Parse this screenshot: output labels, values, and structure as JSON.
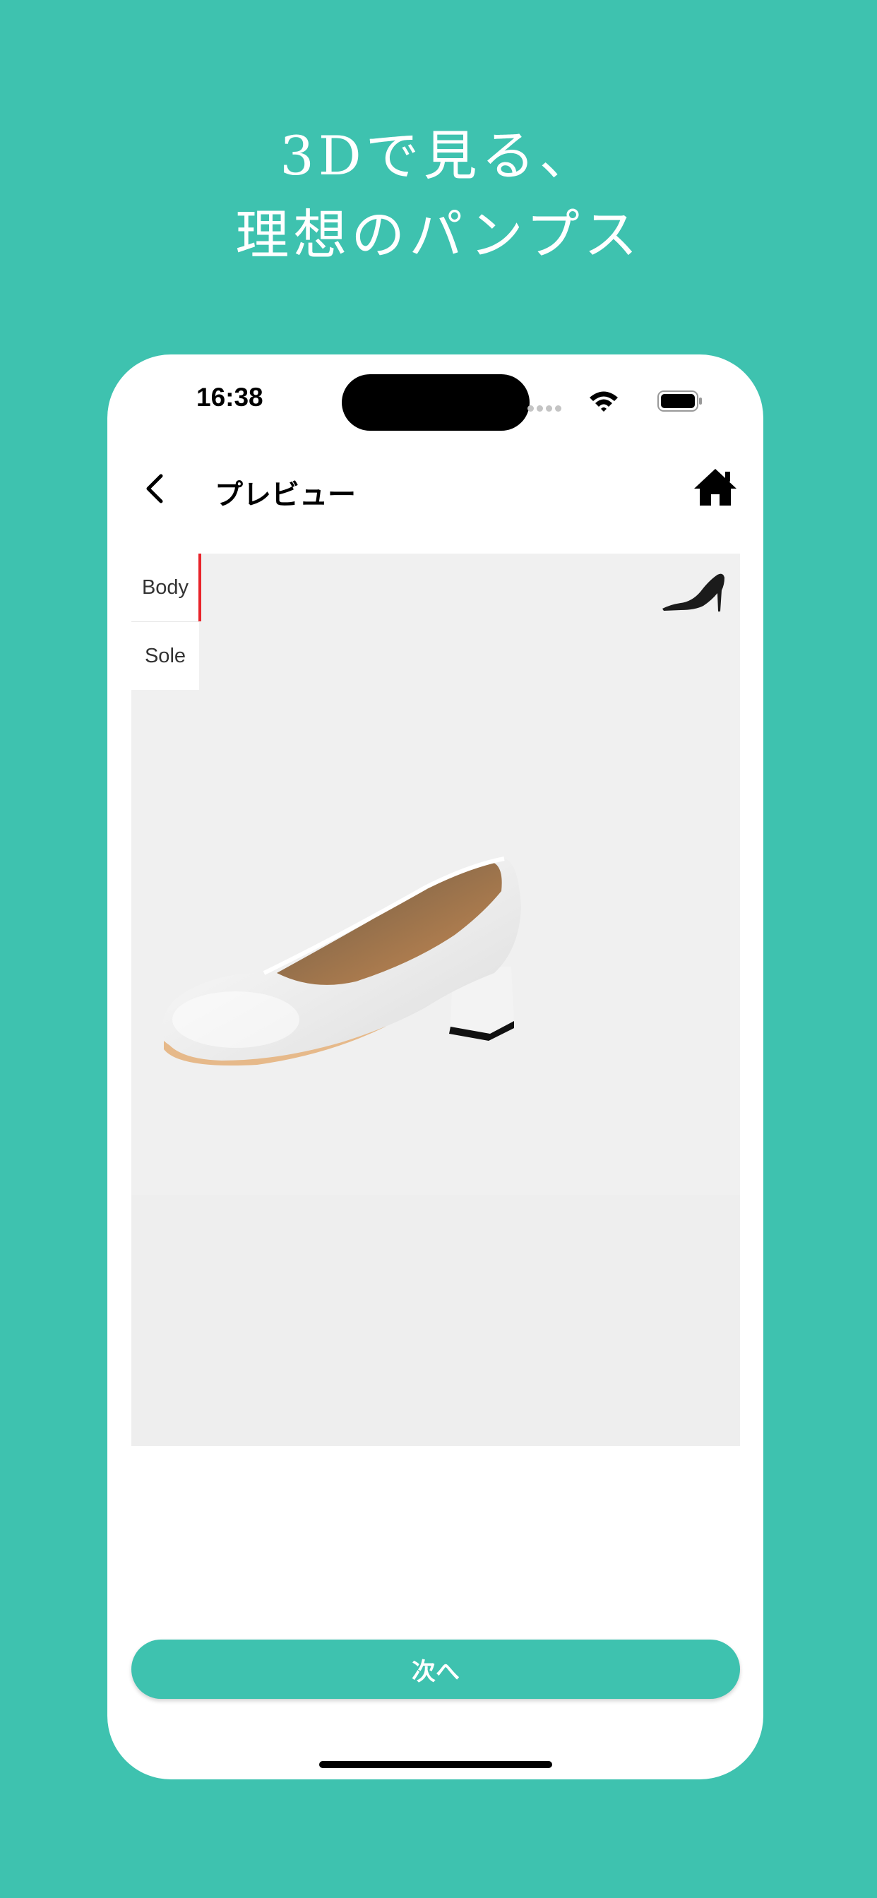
{
  "headline": {
    "line1": "3Dで見る、",
    "line2": "理想のパンプス"
  },
  "status_bar": {
    "time": "16:38"
  },
  "nav": {
    "title": "プレビュー",
    "back_icon": "chevron-left-icon",
    "home_icon": "home-icon"
  },
  "viewer": {
    "tabs": [
      {
        "label": "Body",
        "active": true
      },
      {
        "label": "Sole",
        "active": false
      }
    ],
    "toggle_icon": "high-heel-icon",
    "model": "white-pump-3d-model"
  },
  "footer": {
    "next_label": "次へ"
  },
  "colors": {
    "background": "#3ec2af",
    "button": "#3ec2af",
    "active_tab_indicator": "#e8232a",
    "viewer_background": "#f0f0f0"
  }
}
